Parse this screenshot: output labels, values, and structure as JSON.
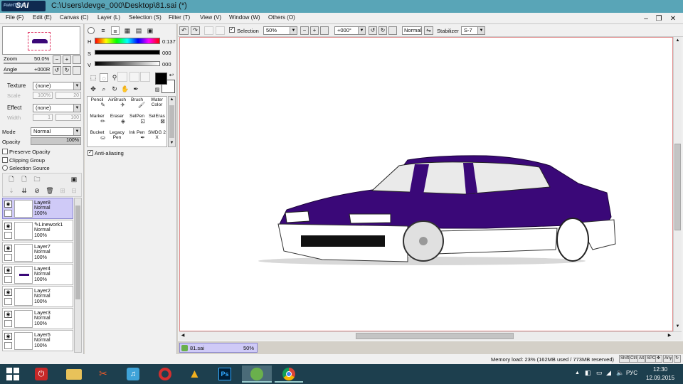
{
  "window": {
    "logo_text": "SAI",
    "logo_small": "PaintTool",
    "title": "C:\\Users\\devge_000\\Desktop\\81.sai (*)"
  },
  "menu": [
    {
      "label": "File (F)"
    },
    {
      "label": "Edit (E)"
    },
    {
      "label": "Canvas (C)"
    },
    {
      "label": "Layer (L)"
    },
    {
      "label": "Selection (S)"
    },
    {
      "label": "Filter (T)"
    },
    {
      "label": "View (V)"
    },
    {
      "label": "Window (W)"
    },
    {
      "label": "Others (O)"
    }
  ],
  "navigator": {
    "zoom_label": "Zoom",
    "zoom_value": "50.0%",
    "angle_label": "Angle",
    "angle_value": "+000R"
  },
  "texture": {
    "label": "Texture",
    "value": "(none)",
    "scale_label": "Scale",
    "scale_value": "100%",
    "num": "20"
  },
  "effect": {
    "label": "Effect",
    "value": "(none)",
    "width_label": "Width",
    "width_value": "1",
    "num": "100"
  },
  "mode": {
    "label": "Mode",
    "value": "Normal"
  },
  "opacity": {
    "label": "Opacity",
    "value": "100%",
    "fraction": 1.0
  },
  "checks": [
    {
      "label": "Preserve Opacity"
    },
    {
      "label": "Clipping Group"
    },
    {
      "label": "Selection Source"
    }
  ],
  "layers": [
    {
      "name": "Layer8",
      "mode": "Normal",
      "opacity": "100%",
      "selected": true
    },
    {
      "name": "Linework1",
      "mode": "Normal",
      "opacity": "100%",
      "selected": false
    },
    {
      "name": "Layer7",
      "mode": "Normal",
      "opacity": "100%",
      "selected": false
    },
    {
      "name": "Layer4",
      "mode": "Normal",
      "opacity": "100%",
      "selected": false
    },
    {
      "name": "Layer2",
      "mode": "Normal",
      "opacity": "100%",
      "selected": false
    },
    {
      "name": "Layer3",
      "mode": "Normal",
      "opacity": "100%",
      "selected": false
    },
    {
      "name": "Layer5",
      "mode": "Normal",
      "opacity": "100%",
      "selected": false
    }
  ],
  "color": {
    "h_label": "H",
    "h_value": "0:137",
    "s_label": "S",
    "s_value": "000",
    "v_label": "V",
    "v_value": "000",
    "primary": "#000000",
    "secondary": "#ffffff"
  },
  "brushes": [
    {
      "label": "Pencil"
    },
    {
      "label": "AirBrush"
    },
    {
      "label": "Brush"
    },
    {
      "label": "Water Color"
    },
    {
      "label": "Marker"
    },
    {
      "label": "Eraser"
    },
    {
      "label": "SelPen"
    },
    {
      "label": "SelEras"
    },
    {
      "label": "Bucket"
    },
    {
      "label": "Legacy Pen"
    },
    {
      "label": "Ink Pen"
    },
    {
      "label": "SMDG 2 X"
    }
  ],
  "antialias": {
    "label": "Anti-aliasing"
  },
  "toolbar": {
    "selection_label": "Selection",
    "zoom_value": "50%",
    "angle_value": "+000°",
    "mode_value": "Normal",
    "stabilizer_label": "Stabilizer",
    "stabilizer_value": "S-7"
  },
  "doc_tab": {
    "name": "81.sai",
    "zoom": "50%"
  },
  "status": {
    "memory": "Memory load: 23% (162MB used / 773MB reserved)",
    "keys": [
      "Shift",
      "Ctrl",
      "Alt",
      "SPC",
      "Any"
    ]
  },
  "tray": {
    "lang": "РУС",
    "time": "12:30",
    "date": "12.09.2015"
  },
  "colors": {
    "car_body": "#3a0878",
    "titlebar": "#59a5b7",
    "selected_layer": "#cfcaf7",
    "taskbar": "#1d3f4e"
  }
}
